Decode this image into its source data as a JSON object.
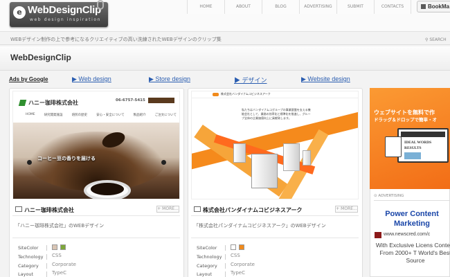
{
  "logo": {
    "name": "WebDesignClip",
    "tagline": "web design inspiration"
  },
  "nav": [
    "HOME",
    "ABOUT",
    "BLOG",
    "ADVERTISING",
    "SUBMIT",
    "CONTACTS"
  ],
  "bookmark_label": "BookMa",
  "site_tagline": "WEBデザイン制作の上で参考になるクリエイティブの高い洗練されたWEBデザインのクリップ集",
  "search_label": "SEARCH",
  "page_title": "WebDesignClip",
  "ads_by": "Ads by Google",
  "ad_links": [
    "▶ Web design",
    "▶ Store design",
    "▶ デザイン",
    "▶ Website design"
  ],
  "cards": [
    {
      "title": "ハニー珈琲株式会社",
      "more": "+ MORE...",
      "desc": "「ハニー珈琲株式会社」のWEBデザイン",
      "labels": {
        "color": "SiteColor",
        "tech": "Technology",
        "category": "Category",
        "layout": "Layout"
      },
      "colors": [
        "#d9c5b4",
        "#7ea73a"
      ],
      "tech": "CSS",
      "category": "Corporate",
      "layout": "TypeC",
      "thumb": {
        "company": "ハニー珈琲株式会社",
        "phone": "06-6757-5415",
        "nav": [
          "HOME",
          "研究開発施設",
          "焙煎の歴史",
          "安心・安全について",
          "製品紹介",
          "ご注文について"
        ],
        "copy": "コーヒー豆の香りを届ける"
      }
    },
    {
      "title": "株式会社パンダイナムコビジネスアーク",
      "more": "+ MORE...",
      "desc": "「株式会社パンダイナムコビジネスアーク」のWEBデザイン",
      "labels": {
        "color": "SiteColor",
        "tech": "Technology",
        "category": "Category",
        "layout": "Layout"
      },
      "colors": [
        "#ffffff",
        "#f08a1c"
      ],
      "tech": "CSS",
      "category": "Corporate",
      "layout": "TypeC",
      "thumb": {
        "company": "株式会社バンダイナムコビジネスアーク",
        "copy": "私たちはバンダイナムコグループの事業基盤を支える機能会社として、業務の効率化と標準化を推進し、グループ全体の企業価値向上に貢献致します。"
      }
    }
  ],
  "ad": {
    "banner_line1": "ウェブサイトを無料で作",
    "banner_line2": "ドラッグ＆ドロップで簡単・オ",
    "banner_screen1": "IDEAL WORDS",
    "banner_screen2": "RESULTS",
    "label": "ADVERTISING",
    "headline": "Power Content Marketing",
    "url": "www.newscred.com/c",
    "body": "With Exclusive Licens Content From 2000+ T World's Best Source"
  }
}
